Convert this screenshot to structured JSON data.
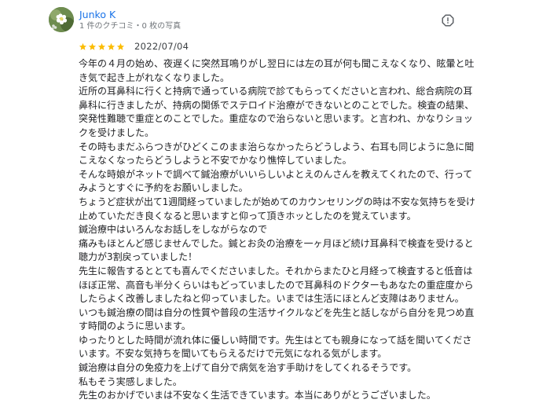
{
  "reviewer": {
    "name": "Junko K",
    "meta": "1 件のクチコミ・0 枚の写真"
  },
  "review": {
    "rating": 5,
    "rating_max": 5,
    "star_color": "#fbbc04",
    "date": "2022/07/04",
    "lines": [
      "今年の４月の始め、夜遅くに突然耳鳴りがし翌日には左の耳が何も聞こえなくなり、眩暈と吐",
      "き気で起き上がれなくなりました。",
      "近所の耳鼻科に行くと持病で通っている病院で診てもらってくださいと言われ、総合病院の耳",
      "鼻科に行きましたが、持病の関係でステロイド治療ができないとのことでした。検査の結果、",
      "突発性難聴で重症とのことでした。重症なので治らないと思います。と言われ、かなりショッ",
      "クを受けました。",
      "その時もまだふらつきがひどくこのまま治らなかったらどうしよう、右耳も同じように急に聞",
      "こえなくなったらどうしようと不安でかなり憔悴していました。",
      "そんな時娘がネットで調べて鍼治療がいいらしいよとえのんさんを教えてくれたので、行って",
      "みようとすぐに予約をお願いしました。",
      "ちょうど症状が出て1週間経っていましたが始めてのカウンセリングの時は不安な気持ちを受け",
      "止めていただき良くなると思いますと仰って頂きホッとしたのを覚えています。",
      "鍼治療中はいろんなお話しをしながらなので",
      "痛みもほとんど感じませんでした。鍼とお灸の治療を一ヶ月ほど続け耳鼻科で検査を受けると",
      "聴力が3割戻っていました！",
      "先生に報告するととても喜んでくださいました。それからまたひと月経って検査すると低音は",
      "ほぼ正常、高音も半分くらいはもどっていましたので耳鼻科のドクターもあなたの重症度から",
      "したらよく改善しましたねと仰っていました。いまでは生活にほとんど支障はありません。",
      "いつも鍼治療の間は自分の性質や普段の生活サイクルなどを先生と話しながら自分を見つめ直",
      "す時間のように思います。",
      "ゆったりとした時間が流れ体に優しい時間です。先生はとても親身になって話を聞いてくださ",
      "います。不安な気持ちを聞いてもらえるだけで元気になれる気がします。",
      "鍼治療は自分の免疫力を上げて自分で病気を治す手助けをしてくれるそうです。",
      "私もそう実感しました。",
      "先生のおかげでいまは不安なく生活できています。本当にありがとうございました。"
    ]
  },
  "icons": {
    "avatar": "avatar-photo",
    "report": "report-flag-icon",
    "star": "star-icon"
  },
  "colors": {
    "name": "#1a73e8",
    "meta": "#70757a",
    "text": "#202124"
  }
}
